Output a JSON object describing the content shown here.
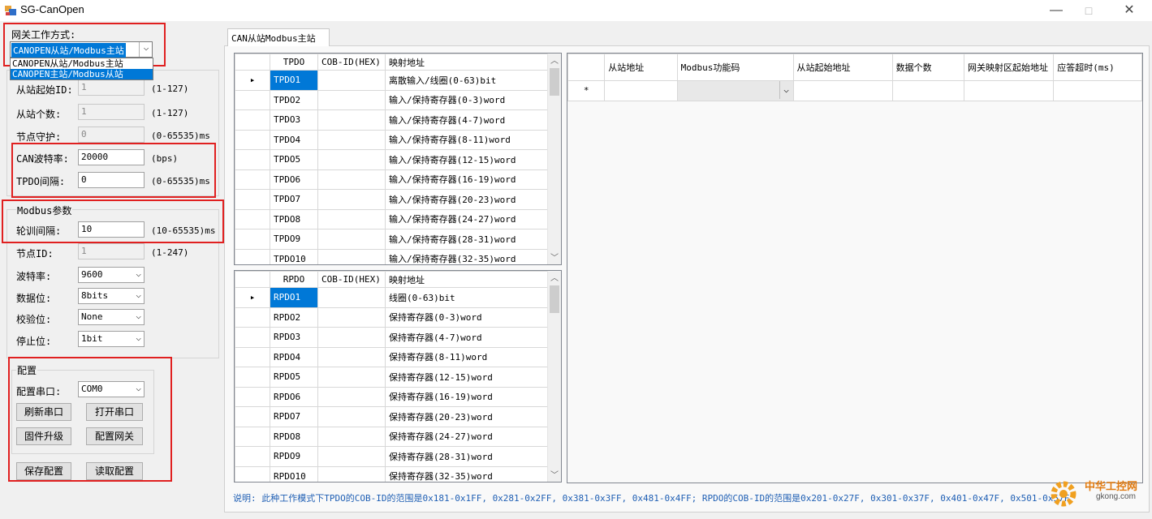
{
  "window": {
    "title": "SG-CanOpen",
    "minimize": "—",
    "maximize": "□",
    "close": "✕"
  },
  "gateway": {
    "label": "网关工作方式:",
    "selected": "CANOPEN从站/Modbus主站",
    "options": [
      "CANOPEN从站/Modbus主站",
      "CANOPEN主站/Modbus从站"
    ]
  },
  "canopen": {
    "start_id": {
      "label": "从站起始ID:",
      "value": "1",
      "hint": "(1-127)"
    },
    "count": {
      "label": "从站个数:",
      "value": "1",
      "hint": "(1-127)"
    },
    "guard": {
      "label": "节点守护:",
      "value": "0",
      "hint": "(0-65535)ms"
    },
    "baud": {
      "label": "CAN波特率:",
      "value": "20000",
      "hint": "(bps)"
    },
    "tpdo": {
      "label": "TPDO间隔:",
      "value": "0",
      "hint": "(0-65535)ms"
    }
  },
  "modbus": {
    "title": "Modbus参数",
    "poll": {
      "label": "轮训间隔:",
      "value": "10",
      "hint": "(10-65535)ms"
    },
    "node": {
      "label": "节点ID:",
      "value": "1",
      "hint": "(1-247)"
    },
    "baud": {
      "label": "波特率:",
      "value": "9600"
    },
    "databits": {
      "label": "数据位:",
      "value": "8bits"
    },
    "parity": {
      "label": "校验位:",
      "value": "None"
    },
    "stopbits": {
      "label": "停止位:",
      "value": "1bit"
    }
  },
  "config": {
    "title": "配置",
    "port_label": "配置串口:",
    "port_value": "COM0",
    "refresh": "刷新串口",
    "open": "打开串口",
    "firmware": "固件升级",
    "configure": "配置网关",
    "save": "保存配置",
    "read": "读取配置"
  },
  "tab": {
    "label": "CAN从站Modbus主站"
  },
  "tpdo_table": {
    "headers": [
      "TPDO",
      "COB-ID(HEX)",
      "映射地址"
    ],
    "rows": [
      [
        "TPDO1",
        "",
        "离散输入/线圈(0-63)bit"
      ],
      [
        "TPDO2",
        "",
        "输入/保持寄存器(0-3)word"
      ],
      [
        "TPDO3",
        "",
        "输入/保持寄存器(4-7)word"
      ],
      [
        "TPDO4",
        "",
        "输入/保持寄存器(8-11)word"
      ],
      [
        "TPDO5",
        "",
        "输入/保持寄存器(12-15)word"
      ],
      [
        "TPDO6",
        "",
        "输入/保持寄存器(16-19)word"
      ],
      [
        "TPDO7",
        "",
        "输入/保持寄存器(20-23)word"
      ],
      [
        "TPDO8",
        "",
        "输入/保持寄存器(24-27)word"
      ],
      [
        "TPDO9",
        "",
        "输入/保持寄存器(28-31)word"
      ],
      [
        "TPDO10",
        "",
        "输入/保持寄存器(32-35)word"
      ]
    ]
  },
  "rpdo_table": {
    "headers": [
      "RPDO",
      "COB-ID(HEX)",
      "映射地址"
    ],
    "rows": [
      [
        "RPDO1",
        "",
        "线圈(0-63)bit"
      ],
      [
        "RPDO2",
        "",
        "保持寄存器(0-3)word"
      ],
      [
        "RPDO3",
        "",
        "保持寄存器(4-7)word"
      ],
      [
        "RPDO4",
        "",
        "保持寄存器(8-11)word"
      ],
      [
        "RPDO5",
        "",
        "保持寄存器(12-15)word"
      ],
      [
        "RPDO6",
        "",
        "保持寄存器(16-19)word"
      ],
      [
        "RPDO7",
        "",
        "保持寄存器(20-23)word"
      ],
      [
        "RPDO8",
        "",
        "保持寄存器(24-27)word"
      ],
      [
        "RPDO9",
        "",
        "保持寄存器(28-31)word"
      ],
      [
        "RPDO10",
        "",
        "保持寄存器(32-35)word"
      ]
    ]
  },
  "modbus_table": {
    "headers": [
      "从站地址",
      "Modbus功能码",
      "从站起始地址",
      "数据个数",
      "网关映射区起始地址",
      "应答超时(ms)"
    ],
    "new_row_marker": "*"
  },
  "note": "说明: 此种工作模式下TPDO的COB-ID的范围是0x181-0x1FF, 0x281-0x2FF, 0x381-0x3FF, 0x481-0x4FF; RPDO的COB-ID的范围是0x201-0x27F, 0x301-0x37F, 0x401-0x47F, 0x501-0x57F",
  "watermark": {
    "text": "中华工控网",
    "url": "gkong.com"
  },
  "colors": {
    "selection": "#0078d7",
    "highlight_box": "#e02020",
    "note_text": "#1f5fb4"
  }
}
